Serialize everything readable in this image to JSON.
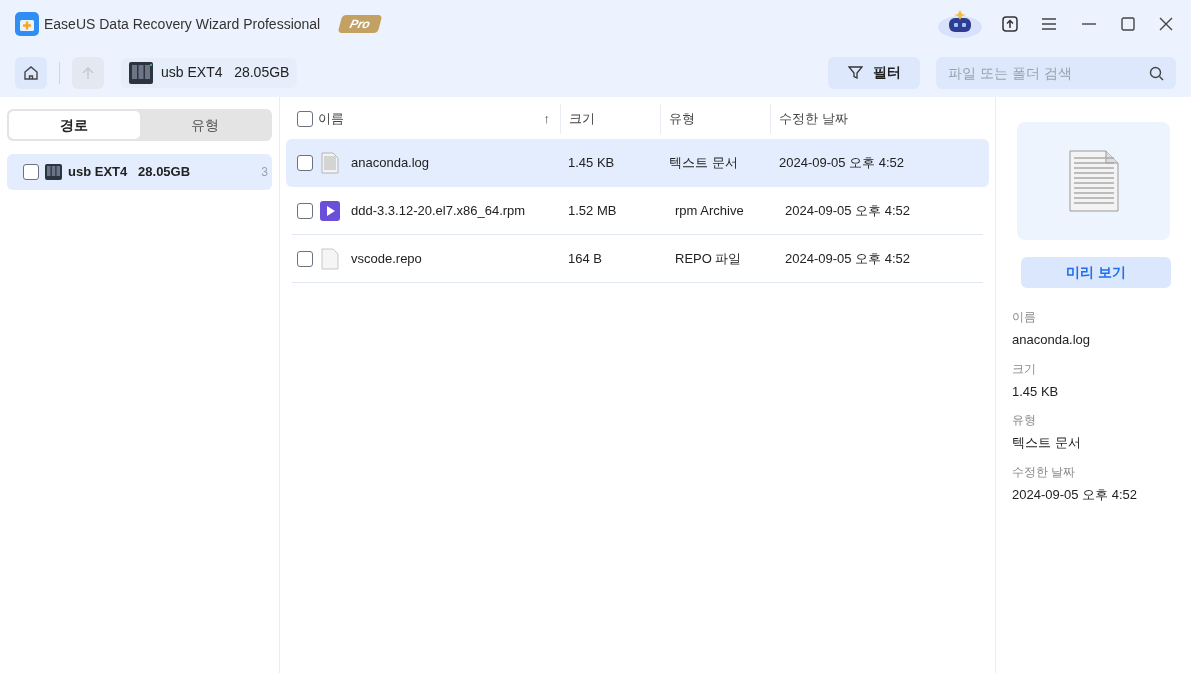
{
  "window": {
    "title": "EaseUS Data Recovery Wizard Professional",
    "edition_badge": "Pro"
  },
  "toolbar": {
    "drive": "usb EXT4   28.05GB",
    "filter_button": "필터",
    "search": {
      "placeholder": "파일 또는 폴더 검색"
    }
  },
  "sidebar": {
    "tabs": [
      {
        "label": "경로",
        "selected": true
      },
      {
        "label": "유형",
        "selected": false
      }
    ],
    "items": [
      {
        "label": "usb EXT4   28.05GB",
        "count": "3",
        "selected": true,
        "checked": false
      }
    ]
  },
  "table": {
    "columns": [
      "이름",
      "크기",
      "유형",
      "수정한 날짜"
    ],
    "sort_mark": "↑",
    "all_checked": false,
    "rows": [
      {
        "kind": "text",
        "name": "anaconda.log",
        "size": "1.45 KB",
        "type": "텍스트 문서",
        "modified": "2024-09-05 오후 4:52",
        "selected": true,
        "checked": false
      },
      {
        "kind": "video",
        "name": "ddd-3.3.12-20.el7.x86_64.rpm",
        "size": "1.52 MB",
        "type": "rpm Archive",
        "modified": "2024-09-05 오후 4:52",
        "selected": false,
        "checked": false
      },
      {
        "kind": "blank",
        "name": "vscode.repo",
        "size": "164 B",
        "type": "REPO 파일",
        "modified": "2024-09-05 오후 4:52",
        "selected": false,
        "checked": false
      }
    ]
  },
  "details": {
    "preview_button": "미리 보기",
    "fields": [
      {
        "label": "이름",
        "value": "anaconda.log"
      },
      {
        "label": "크기",
        "value": "1.45 KB"
      },
      {
        "label": "유형",
        "value": "텍스트 문서"
      },
      {
        "label": "수정한 날짜",
        "value": "2024-09-05 오후 4:52"
      }
    ]
  }
}
